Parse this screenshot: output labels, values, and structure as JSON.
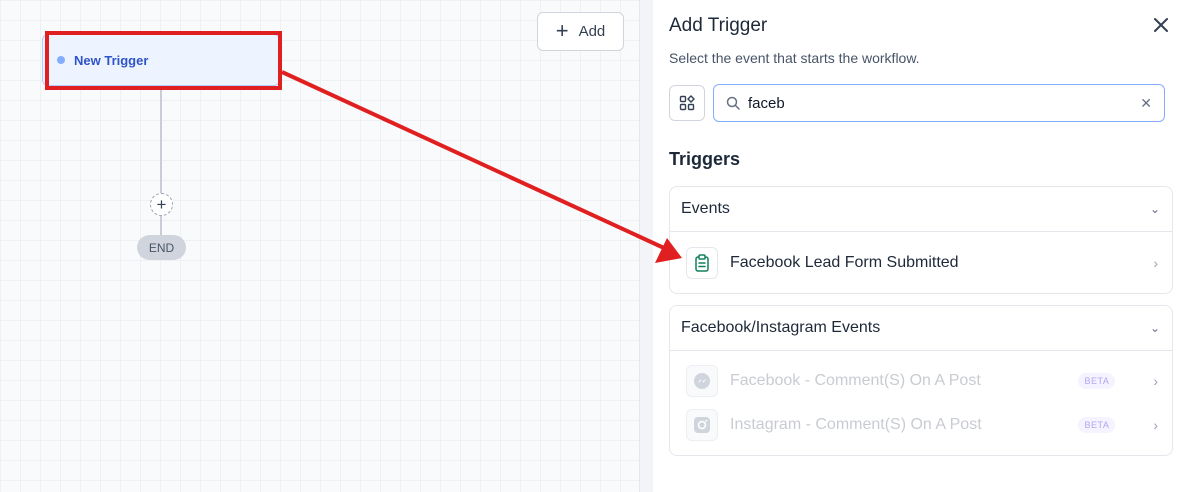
{
  "canvas": {
    "add_label": "Add",
    "trigger_label": "New Trigger",
    "end_label": "END"
  },
  "panel": {
    "title": "Add Trigger",
    "subtitle": "Select the event that starts the workflow.",
    "search_value": "faceb",
    "section_title": "Triggers",
    "groups": [
      {
        "title": "Events",
        "items": [
          {
            "label": "Facebook Lead Form Submitted",
            "icon": "clipboard-icon",
            "enabled": true
          }
        ]
      },
      {
        "title": "Facebook/Instagram Events",
        "items": [
          {
            "label": "Facebook - Comment(S) On A Post",
            "icon": "messenger-icon",
            "badge": "BETA",
            "enabled": false
          },
          {
            "label": "Instagram - Comment(S) On A Post",
            "icon": "instagram-icon",
            "badge": "BETA",
            "enabled": false
          }
        ]
      }
    ]
  },
  "colors": {
    "highlight": "#e02020",
    "trigger_text": "#2f54c8",
    "accent_icon": "#12805c"
  }
}
